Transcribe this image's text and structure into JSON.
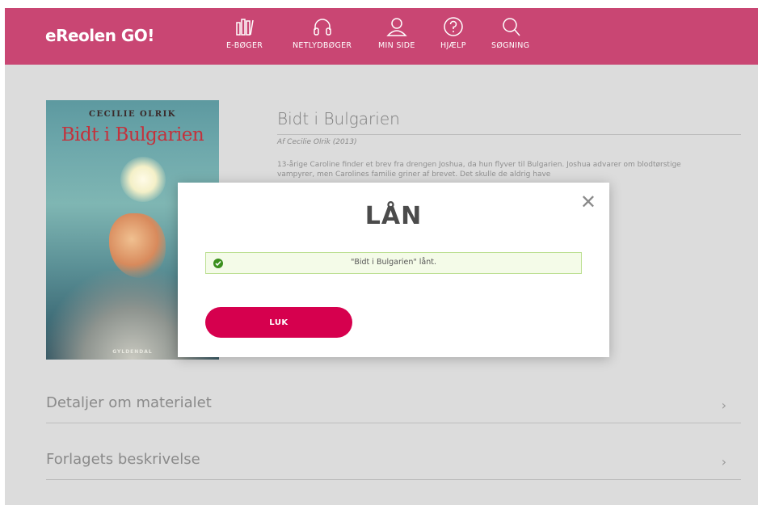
{
  "header": {
    "logo": "eReolen GO!",
    "nav": [
      {
        "label": "E-BØGER",
        "icon": "books-icon"
      },
      {
        "label": "NETLYDBØGER",
        "icon": "headphones-icon"
      },
      {
        "label": "MIN SIDE",
        "icon": "user-icon"
      },
      {
        "label": "HJÆLP",
        "icon": "help-icon"
      },
      {
        "label": "SØGNING",
        "icon": "search-icon"
      }
    ],
    "accent_color": "#c94673"
  },
  "book": {
    "cover": {
      "author": "CECILIE OLRIK",
      "title": "Bidt i Bulgarien",
      "publisher": "GYLDENDAL"
    },
    "title": "Bidt i Bulgarien",
    "byline": "Af Cecilie Olrik (2013)",
    "description": "13-årige Caroline finder et brev fra drengen Joshua, da hun flyver til Bulgarien. Joshua advarer om blodtørstige vampyrer, men Carolines familie griner af brevet. Det skulle de aldrig have"
  },
  "sections": [
    {
      "label": "Detaljer om materialet",
      "chevron": "›"
    },
    {
      "label": "Forlagets beskrivelse",
      "chevron": "›"
    }
  ],
  "modal": {
    "title": "LÅN",
    "close": "✕",
    "message": "\"Bidt i Bulgarien\" lånt.",
    "button": "LUK",
    "button_color": "#d6004e",
    "success_color": "#3b8f1d"
  }
}
